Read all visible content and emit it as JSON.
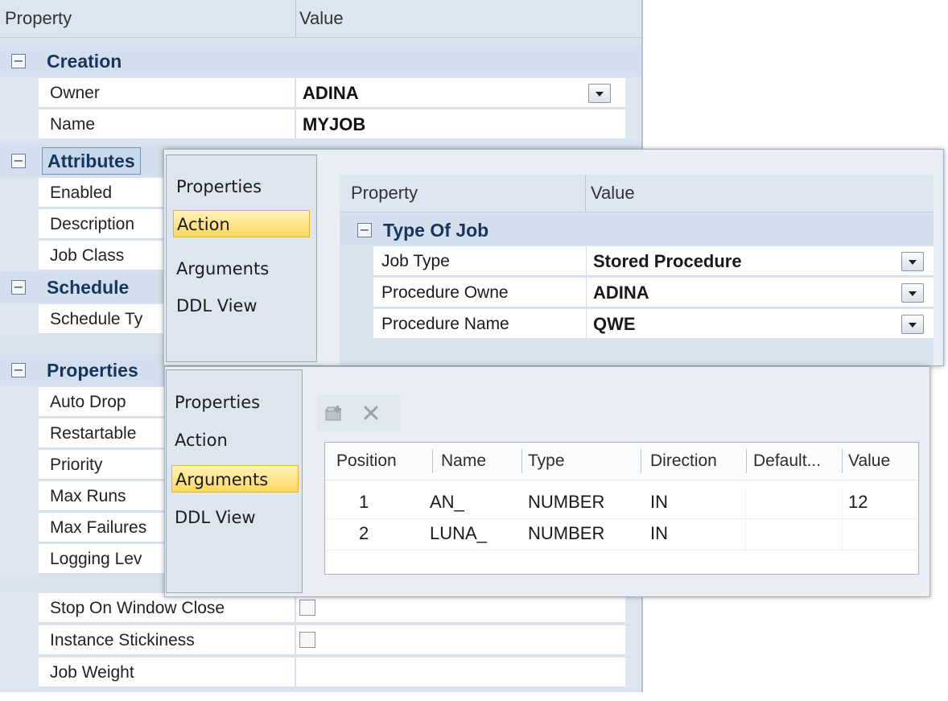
{
  "main_grid": {
    "header": {
      "property": "Property",
      "value": "Value"
    },
    "categories": {
      "creation": "Creation",
      "attributes": "Attributes",
      "schedule": "Schedule",
      "properties": "Properties"
    },
    "rows": {
      "owner": {
        "name": "Owner",
        "value": "ADINA"
      },
      "name": {
        "name": "Name",
        "value": "MYJOB"
      },
      "enabled": {
        "name": "Enabled"
      },
      "description": {
        "name": "Description"
      },
      "job_class": {
        "name": "Job Class"
      },
      "schedule_type": {
        "name": "Schedule Ty"
      },
      "auto_drop": {
        "name": "Auto Drop"
      },
      "restartable": {
        "name": "Restartable"
      },
      "priority": {
        "name": "Priority"
      },
      "max_runs": {
        "name": "Max Runs"
      },
      "max_failures": {
        "name": "Max Failures"
      },
      "logging_level": {
        "name": "Logging Lev"
      },
      "stop_on_window_close": {
        "name": "Stop On Window Close"
      },
      "instance_stickiness": {
        "name": "Instance Stickiness"
      },
      "job_weight": {
        "name": "Job Weight"
      }
    }
  },
  "action_panel": {
    "nav": [
      "Properties",
      "Action",
      "Arguments",
      "DDL View"
    ],
    "selected": "Action",
    "header": {
      "property": "Property",
      "value": "Value"
    },
    "category": "Type Of Job",
    "rows": [
      {
        "name": "Job Type",
        "value": "Stored Procedure"
      },
      {
        "name": "Procedure Owne",
        "value": "ADINA"
      },
      {
        "name": "Procedure Name",
        "value": "QWE"
      }
    ]
  },
  "arguments_panel": {
    "nav": [
      "Properties",
      "Action",
      "Arguments",
      "DDL View"
    ],
    "selected": "Arguments",
    "toolbar": {
      "add_icon": "add-icon",
      "delete_icon": "delete-icon"
    },
    "columns": [
      "Position",
      "Name",
      "Type",
      "Direction",
      "Default...",
      "Value"
    ],
    "rows": [
      [
        "1",
        "AN_",
        "NUMBER",
        "IN",
        "",
        "12"
      ],
      [
        "2",
        "LUNA_",
        "NUMBER",
        "IN",
        "",
        ""
      ]
    ]
  },
  "colors": {
    "category_text": "#17365d",
    "selected_nav": "#ffd75e",
    "grid_background": "#d9e3ef"
  }
}
